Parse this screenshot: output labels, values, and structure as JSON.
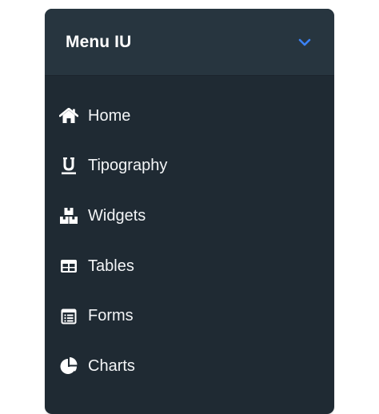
{
  "menu": {
    "title": "Menu IU",
    "items": [
      {
        "label": "Home",
        "icon": "home-icon"
      },
      {
        "label": "Tipography",
        "icon": "underline-icon"
      },
      {
        "label": "Widgets",
        "icon": "widgets-icon"
      },
      {
        "label": "Tables",
        "icon": "table-icon"
      },
      {
        "label": "Forms",
        "icon": "form-icon"
      },
      {
        "label": "Charts",
        "icon": "pie-chart-icon"
      }
    ]
  },
  "colors": {
    "panel": "#1f2a33",
    "header": "#27353f",
    "accent": "#3b82f6",
    "text": "#ffffff"
  }
}
